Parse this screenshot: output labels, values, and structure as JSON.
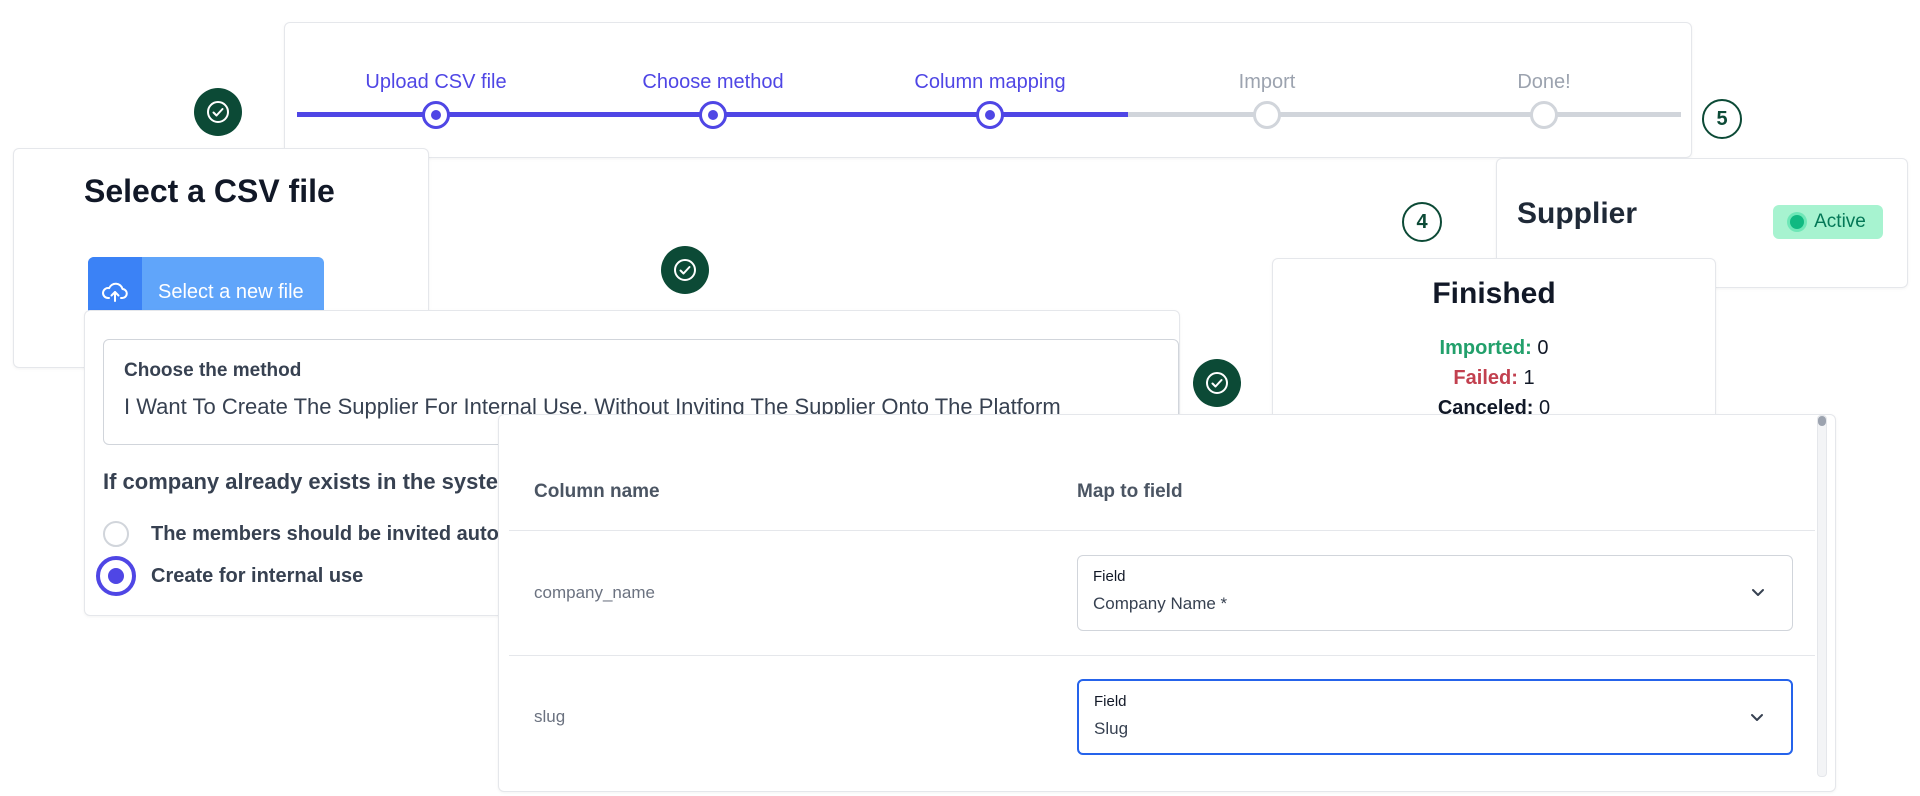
{
  "stepper": {
    "steps": [
      {
        "label": "Upload CSV file",
        "state": "done"
      },
      {
        "label": "Choose method",
        "state": "done"
      },
      {
        "label": "Column mapping",
        "state": "current"
      },
      {
        "label": "Import",
        "state": "todo"
      },
      {
        "label": "Done!",
        "state": "todo"
      }
    ],
    "badge_number": "5"
  },
  "csv_card": {
    "title": "Select a CSV file",
    "button_label": "Select a new file",
    "button_icon": "cloud-upload-icon"
  },
  "method_card": {
    "method_label": "Choose the method",
    "method_value": "I Want To Create The Supplier For Internal Use, Without Inviting The Supplier Onto The Platform",
    "exists_question": "If company already exists in the system",
    "options": [
      {
        "label": "The members should be invited automatically",
        "selected": false
      },
      {
        "label": "Create for internal use",
        "selected": true
      }
    ]
  },
  "finished_card": {
    "title": "Finished",
    "imported_label": "Imported:",
    "imported_value": "0",
    "failed_label": "Failed:",
    "failed_value": "1",
    "canceled_label": "Canceled:",
    "canceled_value": "0",
    "badge_number": "4"
  },
  "supplier_card": {
    "name": "Supplier",
    "status": "Active"
  },
  "mapping_card": {
    "headers": {
      "column_name": "Column name",
      "map_to_field": "Map to field"
    },
    "rows": [
      {
        "column": "company_name",
        "field_label": "Field",
        "field_value": "Company Name *"
      },
      {
        "column": "slug",
        "field_label": "Field",
        "field_value": "Slug"
      }
    ]
  },
  "colors": {
    "primary": "#4f46e5",
    "badge_green": "#0c4a36",
    "imported": "#22a06b",
    "failed": "#c2404f",
    "active_badge_bg": "#a7f3d0",
    "focus_border": "#2563eb"
  }
}
